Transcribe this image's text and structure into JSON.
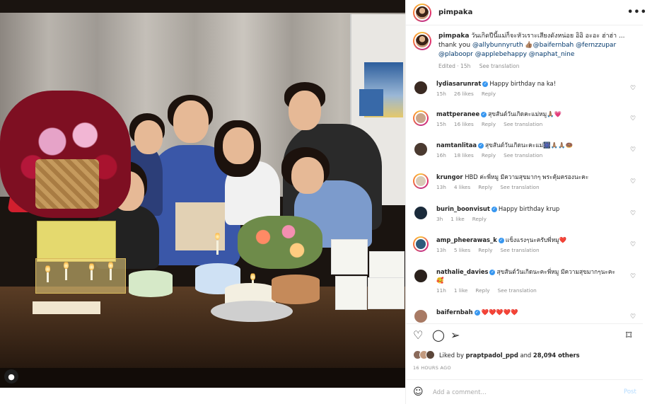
{
  "post": {
    "username": "pimpaka",
    "more_label": "•••",
    "caption_username": "pimpaka",
    "caption_text": "วันเกิดปีนี้แม่ก็จะหัวเราะเสียงดังหน่อย อิอิ อะอะ ฮ่าฮ่า ...",
    "caption_line2_prefix": "thank you ",
    "caption_mentions_a": "@allybunnyruth 👍🏽@baifernbah @fernzzupar",
    "caption_mentions_b": "@plaboopr @applebehappy @naphat_nine",
    "edited": "Edited · 15h",
    "see_translation": "See translation"
  },
  "comments": [
    {
      "user": "lydiasarunrat",
      "verified": true,
      "text": "Happy birthday na ka!",
      "time": "15h",
      "likes": "26 likes",
      "reply": "Reply",
      "translation": "",
      "avatar_color": "#3a2a22",
      "story": false
    },
    {
      "user": "mattperanee",
      "verified": true,
      "text": "สุขสันต์วันเกิดคะแม่หมู🙏🏽💗",
      "time": "15h",
      "likes": "16 likes",
      "reply": "Reply",
      "translation": "See translation",
      "avatar_color": "#c9a58a",
      "story": true
    },
    {
      "user": "namtanlitaa",
      "verified": true,
      "text": "สุขสันต์วันเกิดนะคะแม่🎆🙏🏽🙏🏽🍩",
      "time": "16h",
      "likes": "18 likes",
      "reply": "Reply",
      "translation": "See translation",
      "avatar_color": "#4a3a30",
      "story": false
    },
    {
      "user": "krungor",
      "verified": false,
      "text": "HBD ค่ะพี่หมู มีความสุขมากๆ พระคุ้มครองนะคะ",
      "time": "13h",
      "likes": "4 likes",
      "reply": "Reply",
      "translation": "See translation",
      "avatar_color": "#d8cbb7",
      "story": true
    },
    {
      "user": "burin_boonvisut",
      "verified": true,
      "text": "Happy birthday krup",
      "time": "3h",
      "likes": "1 like",
      "reply": "Reply",
      "translation": "",
      "avatar_color": "#1a2a3a",
      "story": false
    },
    {
      "user": "amp_pheerawas_k",
      "verified": true,
      "text": "แข็งแรงๆนะครับพี่หมู❤️",
      "time": "13h",
      "likes": "5 likes",
      "reply": "Reply",
      "translation": "See translation",
      "avatar_color": "#2e5a7a",
      "story": true
    },
    {
      "user": "nathalie_davies",
      "verified": true,
      "text": "สุขสันต์วันเกิดนะคะพี่หมู มีความสุขมากๆนะคะ",
      "text2": "🥰",
      "time": "11h",
      "likes": "1 like",
      "reply": "Reply",
      "translation": "See translation",
      "avatar_color": "#2a211c",
      "story": false
    },
    {
      "user": "baifernbah",
      "verified": true,
      "text": "❤️❤️❤️❤️❤️",
      "time": "",
      "likes": "",
      "reply": "",
      "translation": "",
      "avatar_color": "#a87a64",
      "story": false
    }
  ],
  "likes": {
    "prefix": "Liked by ",
    "user": "praptpadol_ppd",
    "suffix": " and ",
    "count": "28,094 others"
  },
  "timestamp": "16 HOURS AGO",
  "add_comment": {
    "placeholder": "Add a comment…",
    "post_label": "Post"
  },
  "colors": {
    "link": "#00376b",
    "verified": "#3897f0",
    "muted": "#8e8e8e",
    "post_disabled": "#b3dbff"
  }
}
